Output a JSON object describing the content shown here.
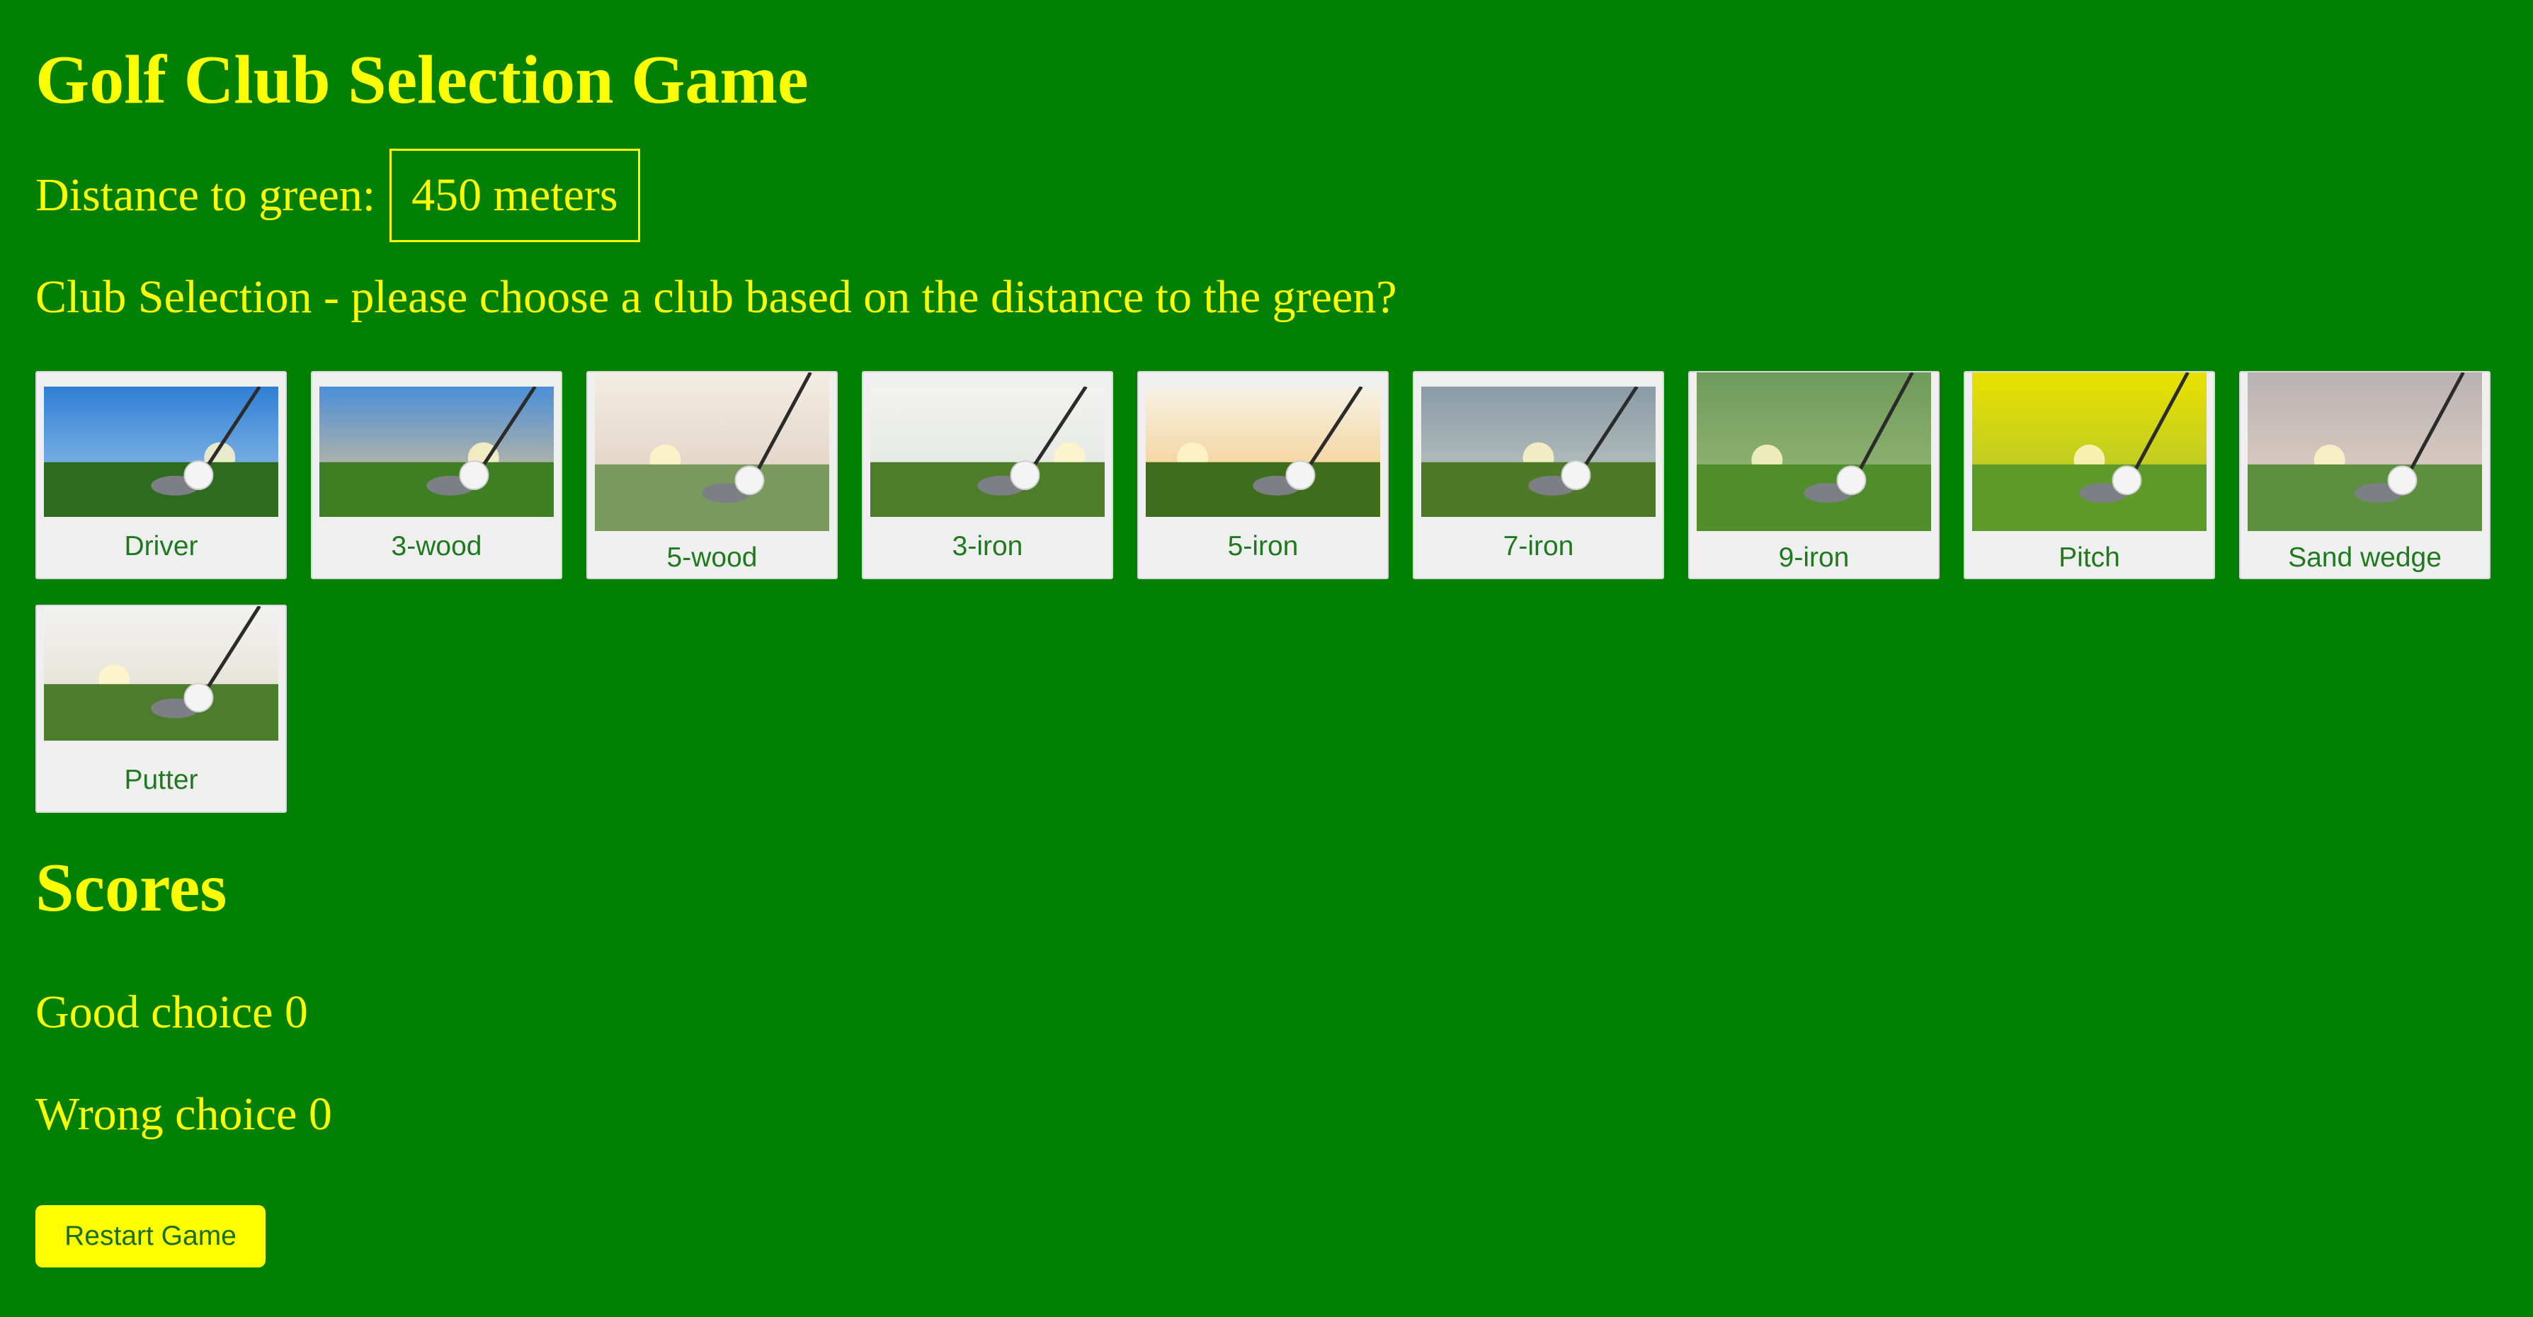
{
  "title": "Golf Club Selection Game",
  "distance": {
    "label": "Distance to green:",
    "value": "450 meters"
  },
  "prompt": "Club Selection - please choose a club based on the distance to the green?",
  "clubs": [
    {
      "name": "Driver",
      "image": "driver-photo-icon"
    },
    {
      "name": "3-wood",
      "image": "3-wood-photo-icon"
    },
    {
      "name": "5-wood",
      "image": "5-wood-photo-icon"
    },
    {
      "name": "3-iron",
      "image": "3-iron-photo-icon"
    },
    {
      "name": "5-iron",
      "image": "5-iron-photo-icon"
    },
    {
      "name": "7-iron",
      "image": "7-iron-photo-icon"
    },
    {
      "name": "9-iron",
      "image": "9-iron-photo-icon"
    },
    {
      "name": "Pitch",
      "image": "pitch-photo-icon"
    },
    {
      "name": "Sand wedge",
      "image": "sand-wedge-photo-icon"
    },
    {
      "name": "Putter",
      "image": "putter-photo-icon"
    }
  ],
  "scores": {
    "heading": "Scores",
    "good_label": "Good choice",
    "good_value": "0",
    "wrong_label": "Wrong choice",
    "wrong_value": "0"
  },
  "restart_label": "Restart Game",
  "colors": {
    "background": "#008000",
    "text": "#ffff00",
    "card": "#efefef",
    "card_text": "#1f7a1f",
    "button": "#ffff00"
  }
}
